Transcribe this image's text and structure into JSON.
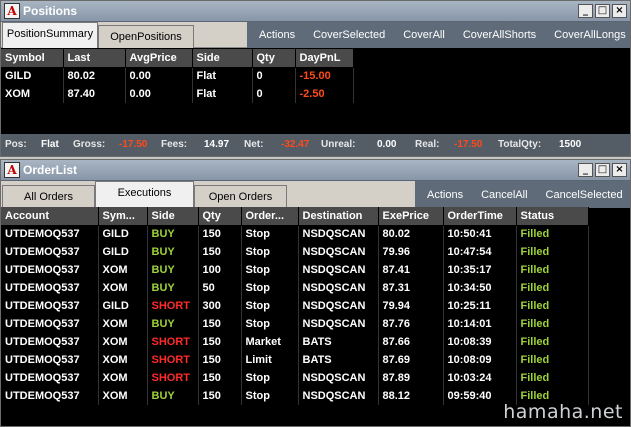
{
  "positions": {
    "title": "Positions",
    "window_buttons": [
      "_",
      "□",
      "×"
    ],
    "tabs": [
      "PositionSummary",
      "OpenPositions"
    ],
    "toolbar": [
      "Actions",
      "CoverSelected",
      "CoverAll",
      "CoverAllShorts",
      "CoverAllLongs"
    ],
    "columns": [
      "Symbol",
      "Last",
      "AvgPrice",
      "Side",
      "Qty",
      "DayPnL"
    ],
    "rows": [
      [
        "GILD",
        "80.02",
        "0.00",
        "Flat",
        "0",
        "-15.00"
      ],
      [
        "XOM",
        "87.40",
        "0.00",
        "Flat",
        "0",
        "-2.50"
      ]
    ],
    "summary": {
      "pos_label": "Pos:",
      "pos": "Flat",
      "gross_label": "Gross:",
      "gross": "-17.50",
      "fees_label": "Fees:",
      "fees": "14.97",
      "net_label": "Net:",
      "net": "-32.47",
      "unreal_label": "Unreal:",
      "unreal": "0.00",
      "real_label": "Real:",
      "real": "-17.50",
      "totalqty_label": "TotalQty:",
      "totalqty": "1500"
    }
  },
  "orderlist": {
    "title": "OrderList",
    "window_buttons": [
      "_",
      "□",
      "×"
    ],
    "tabs": [
      "All Orders",
      "Executions",
      "Open Orders"
    ],
    "toolbar": [
      "Actions",
      "CancelAll",
      "CancelSelected"
    ],
    "columns": [
      "Account",
      "Sym...",
      "Side",
      "Qty",
      "Order...",
      "Destination",
      "ExePrice",
      "OrderTime",
      "Status"
    ],
    "rows": [
      [
        "UTDEMOQ537",
        "GILD",
        "BUY",
        "150",
        "Stop",
        "NSDQSCAN",
        "80.02",
        "10:50:41",
        "Filled"
      ],
      [
        "UTDEMOQ537",
        "GILD",
        "BUY",
        "150",
        "Stop",
        "NSDQSCAN",
        "79.96",
        "10:47:54",
        "Filled"
      ],
      [
        "UTDEMOQ537",
        "XOM",
        "BUY",
        "100",
        "Stop",
        "NSDQSCAN",
        "87.41",
        "10:35:17",
        "Filled"
      ],
      [
        "UTDEMOQ537",
        "XOM",
        "BUY",
        "50",
        "Stop",
        "NSDQSCAN",
        "87.31",
        "10:34:50",
        "Filled"
      ],
      [
        "UTDEMOQ537",
        "GILD",
        "SHORT",
        "300",
        "Stop",
        "NSDQSCAN",
        "79.94",
        "10:25:11",
        "Filled"
      ],
      [
        "UTDEMOQ537",
        "XOM",
        "BUY",
        "150",
        "Stop",
        "NSDQSCAN",
        "87.76",
        "10:14:01",
        "Filled"
      ],
      [
        "UTDEMOQ537",
        "XOM",
        "SHORT",
        "150",
        "Market",
        "BATS",
        "87.66",
        "10:08:39",
        "Filled"
      ],
      [
        "UTDEMOQ537",
        "XOM",
        "SHORT",
        "150",
        "Limit",
        "BATS",
        "87.69",
        "10:08:09",
        "Filled"
      ],
      [
        "UTDEMOQ537",
        "XOM",
        "SHORT",
        "150",
        "Stop",
        "NSDQSCAN",
        "87.89",
        "10:03:24",
        "Filled"
      ],
      [
        "UTDEMOQ537",
        "XOM",
        "BUY",
        "150",
        "Stop",
        "NSDQSCAN",
        "88.12",
        "09:59:40",
        "Filled"
      ]
    ]
  },
  "colors": {
    "buy": "#9ed23a",
    "short": "#ff2a2a",
    "negative": "#ff4a1c",
    "filled": "#9ed23a"
  },
  "watermark": "hamaha.net"
}
